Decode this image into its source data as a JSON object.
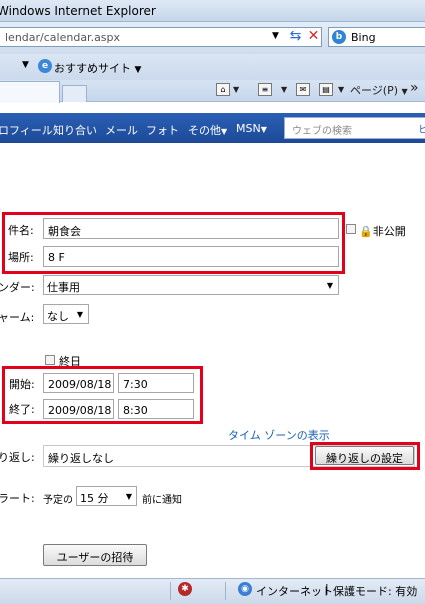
{
  "window": {
    "title": "Windows Internet Explorer"
  },
  "address": {
    "url": "lendar/calendar.aspx"
  },
  "search": {
    "provider": "Bing"
  },
  "favorites": {
    "label": "おすすめサイト"
  },
  "commandbar": {
    "page_label": "ページ(P)"
  },
  "nav": {
    "items": [
      "ロフィール",
      "知り合い",
      "メール",
      "フォト",
      "その他",
      "MSN"
    ],
    "search_placeholder": "ウェブの検索",
    "search_tail": "ヒ"
  },
  "form": {
    "subject_label": "件名:",
    "subject_value": "朝食会",
    "private_label": "非公開",
    "location_label": "場所:",
    "location_value": "8 F",
    "calendar_label": "ンダー:",
    "calendar_value": "仕事用",
    "alarm_label": "ャーム:",
    "alarm_value": "なし",
    "allday_label": "終日",
    "start_label": "開始:",
    "start_date": "2009/08/18",
    "start_time": "7:30",
    "end_label": "終了:",
    "end_date": "2009/08/18",
    "end_time": "8:30",
    "timezone_link": "タイム ゾーンの表示",
    "repeat_label": "り返し:",
    "repeat_value": "繰り返しなし",
    "repeat_button": "繰り返しの設定",
    "alert_label": "ラート:",
    "alert_prefix": "予定の",
    "alert_value": "15 分",
    "alert_suffix": "前に通知",
    "invite_button": "ユーザーの招待"
  },
  "status": {
    "zone": "インターネット",
    "protected_mode": "保護モード: 有効"
  },
  "colors": {
    "accent_red": "#e3001b",
    "nav_blue": "#2a5fb4"
  }
}
